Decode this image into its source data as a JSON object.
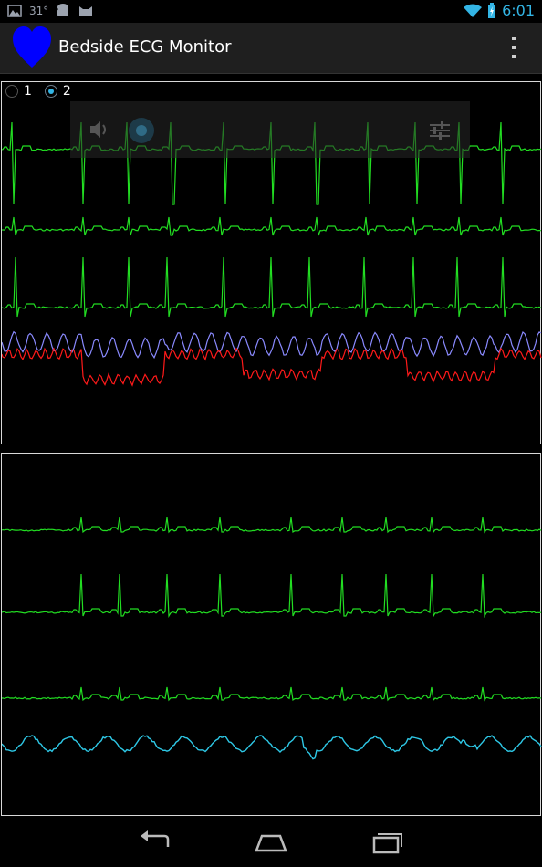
{
  "status_bar": {
    "temperature": "31°",
    "time": "6:01",
    "icons": [
      "image-notification-icon",
      "android-icon",
      "cat-icon",
      "wifi-icon",
      "battery-charging-icon"
    ]
  },
  "action_bar": {
    "title": "Bedside ECG Monitor",
    "app_icon": "heart-icon",
    "overflow_icon": "overflow-menu-icon"
  },
  "screen_selector": {
    "options": [
      "1",
      "2"
    ],
    "selected": "2"
  },
  "media_overlay": {
    "icons": [
      "speaker-icon",
      "circle-icon",
      "sliders-icon"
    ]
  },
  "panels": [
    {
      "traces": [
        {
          "name": "lead-1",
          "color": "#22dd22"
        },
        {
          "name": "lead-2",
          "color": "#22dd22"
        },
        {
          "name": "lead-3",
          "color": "#22dd22"
        },
        {
          "name": "signal-blue",
          "color": "#8a8aff"
        },
        {
          "name": "signal-red",
          "color": "#ff1a1a"
        }
      ]
    },
    {
      "traces": [
        {
          "name": "lead-4",
          "color": "#22dd22"
        },
        {
          "name": "lead-5",
          "color": "#22dd22"
        },
        {
          "name": "lead-6",
          "color": "#22dd22"
        },
        {
          "name": "signal-cyan",
          "color": "#2ec8e6"
        }
      ]
    }
  ],
  "nav_bar": {
    "icons": [
      "back-icon",
      "home-icon",
      "recent-apps-icon"
    ]
  }
}
